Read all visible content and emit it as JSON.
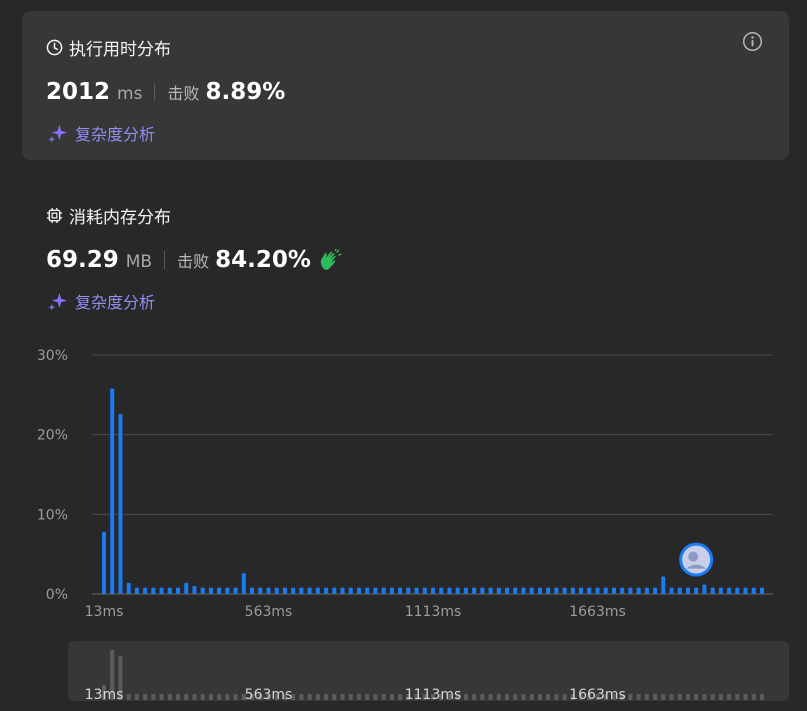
{
  "runtime": {
    "title": "执行用时分布",
    "value": "2012",
    "unit": "ms",
    "beat_label": "击败",
    "beat_pct": "8.89%",
    "complexity_label": "复杂度分析"
  },
  "memory": {
    "title": "消耗内存分布",
    "value": "69.29",
    "unit": "MB",
    "beat_label": "击败",
    "beat_pct": "84.20%",
    "complexity_label": "复杂度分析"
  },
  "colors": {
    "bar": "#1a7cf4",
    "accent_purple": "#8e8ef5",
    "clap_green": "#2cbb5d",
    "card_bg": "#373737",
    "page_bg": "#282828"
  },
  "icons": {
    "runtime": "clock-icon",
    "memory": "chip-icon",
    "info": "info-icon",
    "sparkle": "sparkle-icon",
    "clap": "clap-icon"
  },
  "chart_data": {
    "type": "bar",
    "x_tick_labels": [
      "13ms",
      "563ms",
      "1113ms",
      "1663ms"
    ],
    "y_tick_labels": [
      "0%",
      "10%",
      "20%",
      "30%"
    ],
    "ylim": [
      0,
      30
    ],
    "grid": true,
    "highlight_bar_index": 72,
    "values": [
      7.8,
      25.8,
      22.6,
      1.4,
      0.8,
      0.8,
      0.8,
      0.8,
      0.8,
      0.8,
      1.4,
      1.0,
      0.8,
      0.8,
      0.8,
      0.8,
      0.8,
      2.6,
      0.8,
      0.8,
      0.8,
      0.8,
      0.8,
      0.8,
      0.8,
      0.8,
      0.8,
      0.8,
      0.8,
      0.8,
      0.8,
      0.8,
      0.8,
      0.8,
      0.8,
      0.8,
      0.8,
      0.8,
      0.8,
      0.8,
      0.8,
      0.8,
      0.8,
      0.8,
      0.8,
      0.8,
      0.8,
      0.8,
      0.8,
      0.8,
      0.8,
      0.8,
      0.8,
      0.8,
      0.8,
      0.8,
      0.8,
      0.8,
      0.8,
      0.8,
      0.8,
      0.8,
      0.8,
      0.8,
      0.8,
      0.8,
      0.8,
      0.8,
      2.2,
      0.8,
      0.8,
      0.8,
      0.8,
      1.2,
      0.8,
      0.8,
      0.8,
      0.8,
      0.8,
      0.8,
      0.8
    ]
  }
}
